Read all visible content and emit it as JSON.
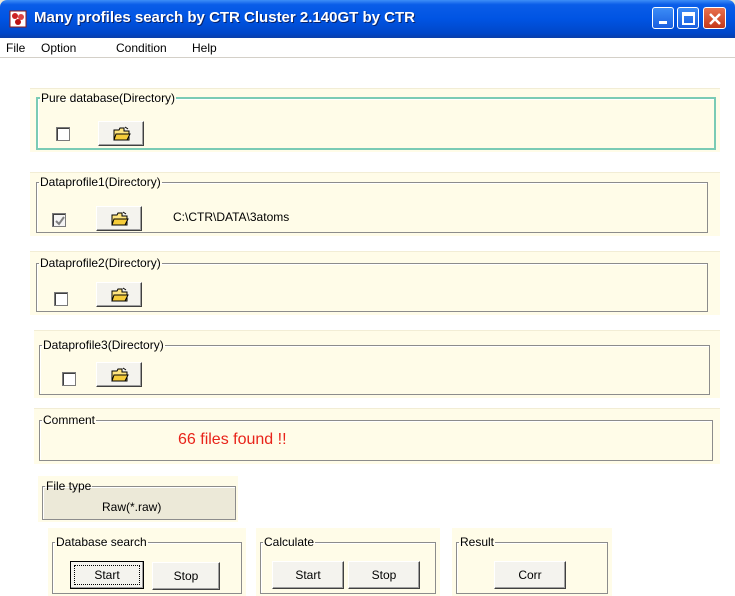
{
  "window": {
    "title": "Many profiles search by CTR  Cluster 2.140GT by CTR",
    "app_icon": "cluster-app-icon",
    "controls": [
      "minimize-icon",
      "maximize-icon",
      "close-icon"
    ]
  },
  "menu": {
    "file": "File",
    "option": "Option",
    "condition": "Condition",
    "help": "Help"
  },
  "pure_db": {
    "legend": "Pure database(Directory)",
    "checked": false,
    "path": ""
  },
  "dataprofile1": {
    "legend": "Dataprofile1(Directory)",
    "checked": true,
    "path": "C:\\CTR\\DATA\\3atoms"
  },
  "dataprofile2": {
    "legend": "Dataprofile2(Directory)",
    "checked": false,
    "path": ""
  },
  "dataprofile3": {
    "legend": "Dataprofile3(Directory)",
    "checked": false,
    "path": ""
  },
  "comment": {
    "legend": "Comment",
    "text": "66 files found !!"
  },
  "file_type": {
    "legend": "File type",
    "value": "Raw(*.raw)"
  },
  "database_search": {
    "legend": "Database search",
    "start": "Start",
    "stop": "Stop"
  },
  "calculate": {
    "legend": "Calculate",
    "start": "Start",
    "stop": "Stop"
  },
  "result": {
    "legend": "Result",
    "corr": "Corr"
  },
  "colors": {
    "titlebar": "#0054E3",
    "panel_bg": "#FFFCE8",
    "comment_text": "#E8231A",
    "focus_border": "#7ACBB5"
  }
}
